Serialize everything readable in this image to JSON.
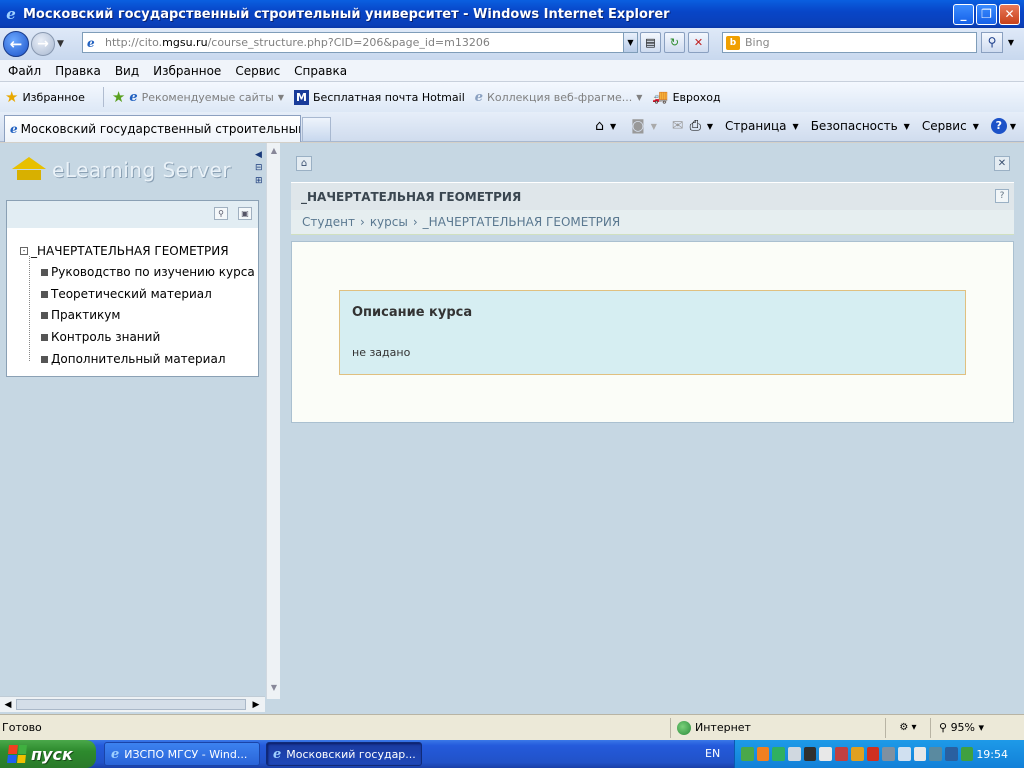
{
  "window": {
    "title": "Московский государственный строительный университет - Windows Internet Explorer",
    "controls": {
      "minimize": "_",
      "maximize": "❐",
      "close": "✕"
    }
  },
  "address": {
    "url_prefix": "http://cito.",
    "url_domain": "mgsu.ru",
    "url_path": "/course_structure.php?CID=206&page_id=m13206",
    "search_placeholder": "Bing"
  },
  "menu": {
    "items": [
      "Файл",
      "Правка",
      "Вид",
      "Избранное",
      "Сервис",
      "Справка"
    ]
  },
  "favorites": {
    "label": "Избранное",
    "items": [
      {
        "label": "Рекомендуемые сайты",
        "grey": true
      },
      {
        "label": "Бесплатная почта Hotmail",
        "grey": false
      },
      {
        "label": "Коллекция веб-фрагме...",
        "grey": true
      },
      {
        "label": "Евроход",
        "grey": false
      }
    ]
  },
  "tabs": {
    "active": "Московский государственный строительный унив..."
  },
  "commandbar": {
    "page": "Страница",
    "safety": "Безопасность",
    "tools": "Сервис"
  },
  "app": {
    "logo_text": "eLearning Server",
    "tree": {
      "root": "_НАЧЕРТАТЕЛЬНАЯ ГЕОМЕТРИЯ",
      "items": [
        "Руководство по изучению курса",
        "Теоретический материал",
        "Практикум",
        "Контроль знаний",
        "Дополнительный материал"
      ]
    },
    "course_title": "_НАЧЕРТАТЕЛЬНАЯ ГЕОМЕТРИЯ",
    "breadcrumb": {
      "items": [
        "Студент",
        "курсы",
        "_НАЧЕРТАТЕЛЬНАЯ ГЕОМЕТРИЯ"
      ],
      "separator": "›"
    },
    "description": {
      "title": "Описание курса",
      "value": "не задано"
    }
  },
  "status": {
    "text": "Готово",
    "zone": "Интернет",
    "zoom": "95%"
  },
  "taskbar": {
    "start": "пуск",
    "buttons": [
      "ИЗСПО МГСУ - Wind...",
      "Московский государ..."
    ],
    "language": "EN",
    "clock": "19:54"
  },
  "colors": {
    "accent": "#245adb",
    "content_bg": "#c6d7e3",
    "desc_border": "#e0c080"
  }
}
